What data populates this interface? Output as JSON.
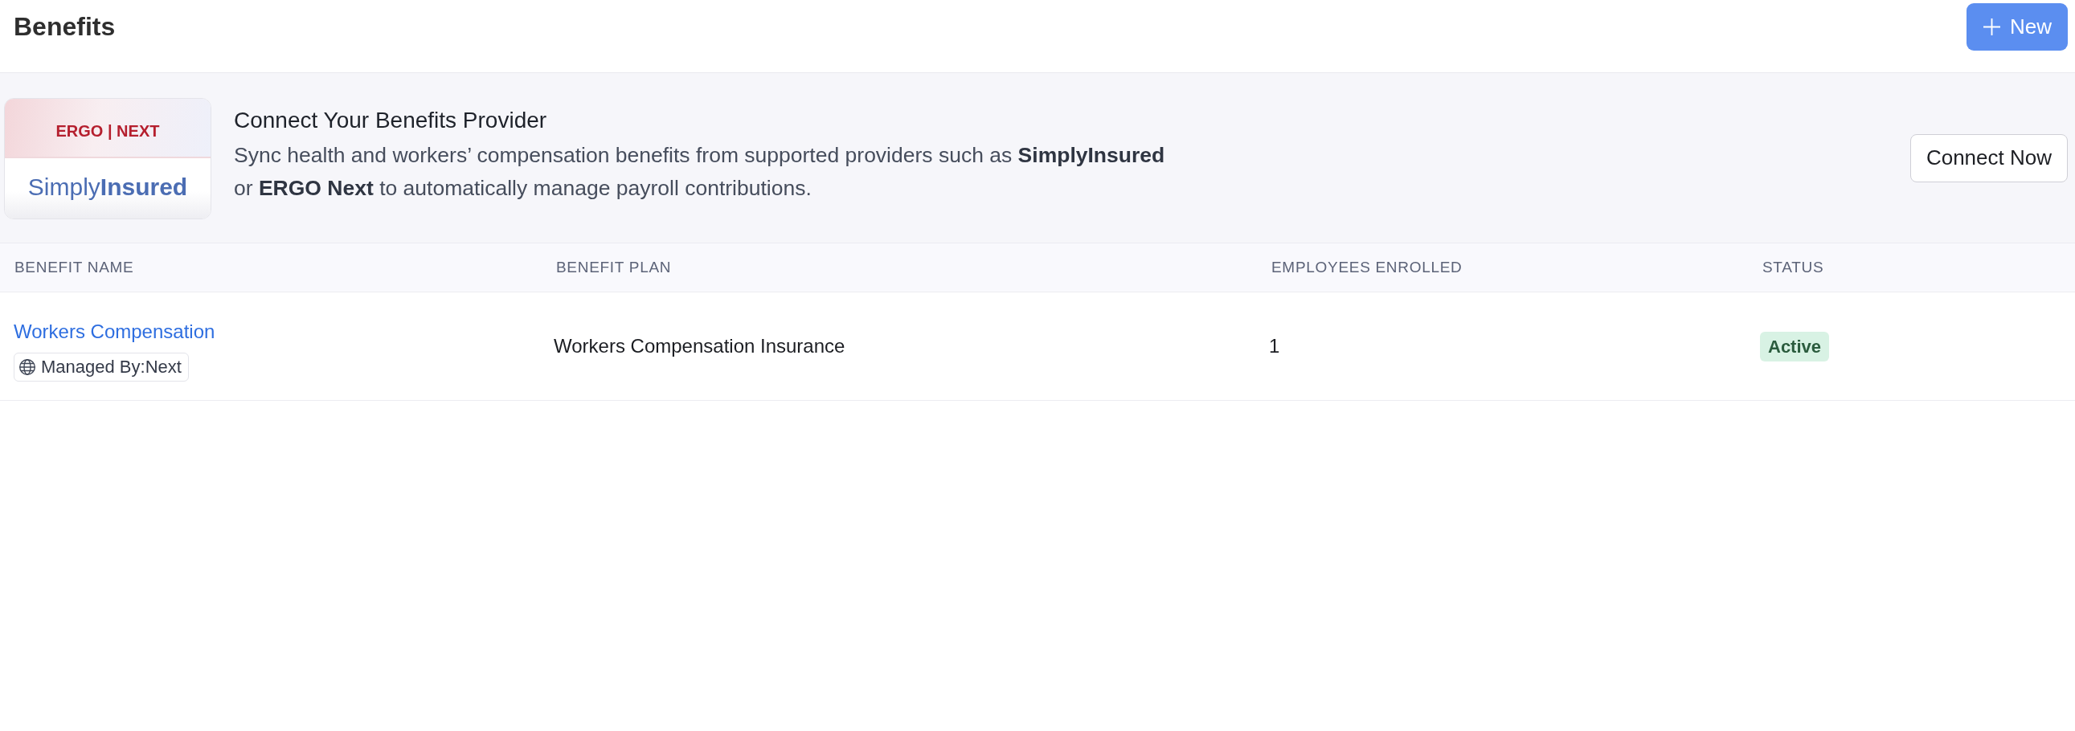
{
  "page": {
    "title": "Benefits",
    "new_button": "New"
  },
  "banner": {
    "logo": {
      "top": "ERGO | NEXT",
      "bottom": "Simply**Insured**"
    },
    "title": "Connect Your Benefits Provider",
    "description": "Sync health and workers’ compensation benefits from supported providers such as **SimplyInsured** or **ERGO Next** to automatically manage payroll contributions.",
    "button": "Connect Now"
  },
  "table": {
    "columns": [
      "BENEFIT NAME",
      "BENEFIT PLAN",
      "EMPLOYEES ENROLLED",
      "STATUS"
    ],
    "rows": [
      {
        "name": "Workers Compensation",
        "managed_by": "Managed By:Next",
        "plan": "Workers Compensation Insurance",
        "enrolled": "1",
        "status": {
          "label": "Active",
          "kind": "active"
        }
      }
    ]
  }
}
